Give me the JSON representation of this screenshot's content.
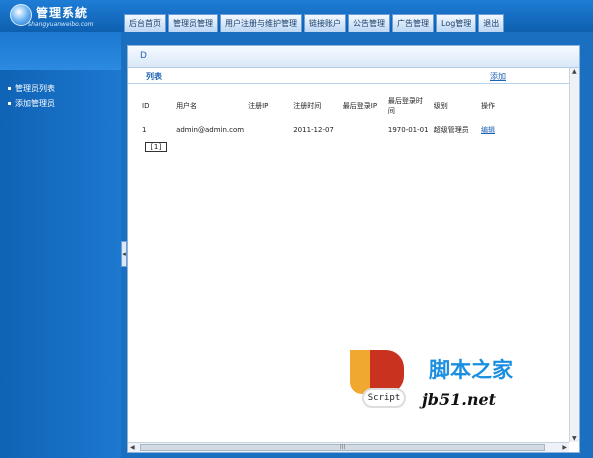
{
  "header": {
    "title": "管理系統",
    "subtitle": "shangyuanweibo.com",
    "nav_tabs": [
      "后台首页",
      "管理员管理",
      "用户注册与维护管理",
      "链接账户",
      "公告管理",
      "广告管理",
      "Log管理",
      "退出"
    ]
  },
  "sidebar": {
    "items": [
      "管理员列表",
      "添加管理员"
    ]
  },
  "main": {
    "breadcrumb_icon": "D",
    "list_label": "列表",
    "add_label": "添加",
    "columns": [
      "ID",
      "用户名",
      "注册IP",
      "注册时间",
      "最后登录IP",
      "最后登录时间",
      "级别",
      "操作"
    ],
    "rows": [
      {
        "id": "1",
        "username": "admin@admin.com",
        "reg_ip": "",
        "reg_time": "2011-12-07",
        "last_ip": "",
        "last_time": "1970-01-01",
        "level": "超级管理员",
        "action": "编辑"
      }
    ],
    "pager": "[1]"
  },
  "watermark": {
    "brand_cn": "脚本之家",
    "url": "jb51.net",
    "script": "Script"
  },
  "colors": {
    "header_blue": "#0e5fae",
    "sidebar_blue": "#1d78cf",
    "link_blue": "#1c62b5"
  }
}
